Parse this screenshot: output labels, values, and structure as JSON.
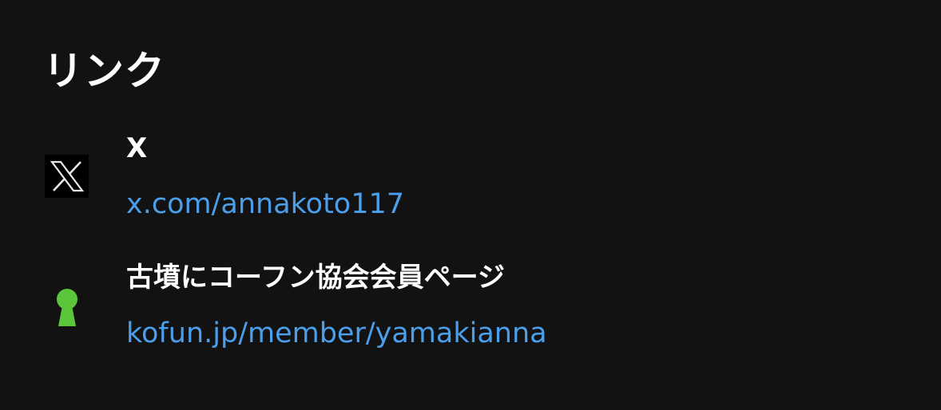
{
  "section": {
    "title": "リンク"
  },
  "links": [
    {
      "title": "X",
      "url_text": "x.com/annakoto117",
      "icon": "x-logo-icon"
    },
    {
      "title": "古墳にコーフン協会会員ページ",
      "url_text": "kofun.jp/member/yamakianna",
      "icon": "keyhole-kofun-icon"
    }
  ],
  "colors": {
    "background": "#121212",
    "text": "#ffffff",
    "link": "#4a9eea",
    "kofun_icon": "#5cc63a"
  }
}
